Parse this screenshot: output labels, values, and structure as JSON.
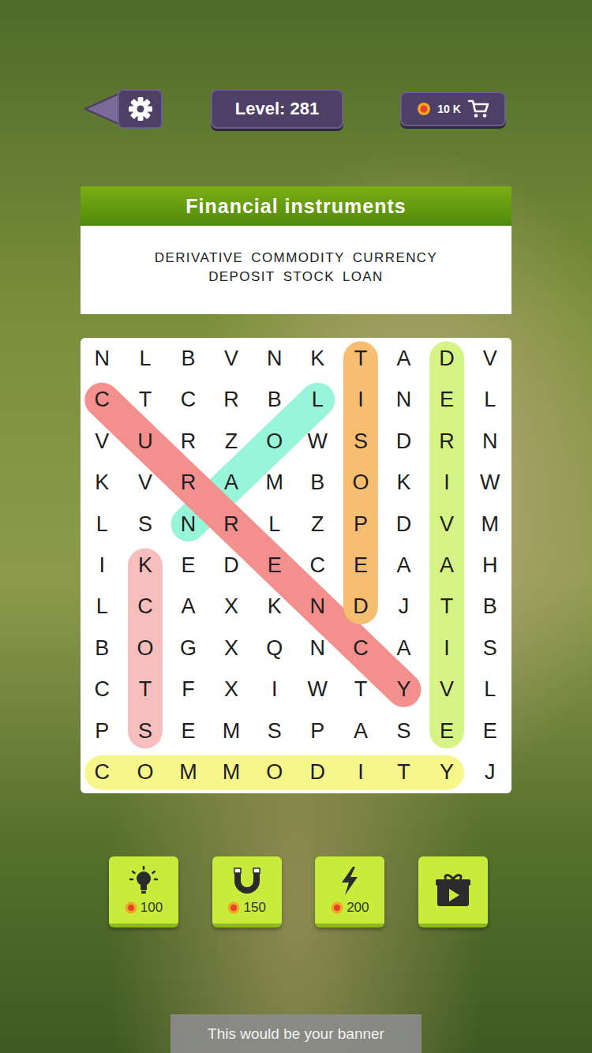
{
  "topbar": {
    "level": "Level: 281",
    "coins": "10 K"
  },
  "puzzle": {
    "title": "Financial instruments",
    "word_lines": [
      [
        "DERIVATIVE",
        "COMMODITY",
        "CURRENCY"
      ],
      [
        "DEPOSIT",
        "STOCK",
        "LOAN"
      ]
    ]
  },
  "grid": {
    "rows": [
      [
        "N",
        "L",
        "B",
        "V",
        "N",
        "K",
        "T",
        "A",
        "D",
        "V"
      ],
      [
        "C",
        "T",
        "C",
        "R",
        "B",
        "L",
        "I",
        "N",
        "E",
        "L"
      ],
      [
        "V",
        "U",
        "R",
        "Z",
        "O",
        "W",
        "S",
        "D",
        "R",
        "N"
      ],
      [
        "K",
        "V",
        "R",
        "A",
        "M",
        "B",
        "O",
        "K",
        "I",
        "W"
      ],
      [
        "L",
        "S",
        "N",
        "R",
        "L",
        "Z",
        "P",
        "D",
        "V",
        "M"
      ],
      [
        "I",
        "K",
        "E",
        "D",
        "E",
        "C",
        "E",
        "A",
        "A",
        "H"
      ],
      [
        "L",
        "C",
        "A",
        "X",
        "K",
        "N",
        "D",
        "J",
        "T",
        "B"
      ],
      [
        "B",
        "O",
        "G",
        "X",
        "Q",
        "N",
        "C",
        "A",
        "I",
        "S"
      ],
      [
        "C",
        "T",
        "F",
        "X",
        "I",
        "W",
        "T",
        "Y",
        "V",
        "L"
      ],
      [
        "P",
        "S",
        "E",
        "M",
        "S",
        "P",
        "A",
        "S",
        "E",
        "E"
      ],
      [
        "C",
        "O",
        "M",
        "M",
        "O",
        "D",
        "I",
        "T",
        "Y",
        "J"
      ]
    ]
  },
  "found": [
    {
      "word": "LOAN",
      "from": [
        1,
        5
      ],
      "to": [
        4,
        2
      ],
      "color": "#8ff5d6"
    },
    {
      "word": "CURRENCY",
      "from": [
        1,
        0
      ],
      "to": [
        8,
        7
      ],
      "color": "#f28482"
    },
    {
      "word": "DEPOSIT",
      "from": [
        6,
        6
      ],
      "to": [
        0,
        6
      ],
      "color": "#f7b862"
    },
    {
      "word": "DERIVATIVE",
      "from": [
        0,
        8
      ],
      "to": [
        9,
        8
      ],
      "color": "#d2f27a"
    },
    {
      "word": "STOCK",
      "from": [
        9,
        1
      ],
      "to": [
        5,
        1
      ],
      "color": "#f6b9b6"
    },
    {
      "word": "COMMODITY",
      "from": [
        10,
        0
      ],
      "to": [
        10,
        8
      ],
      "color": "#f6f67e"
    }
  ],
  "tools": [
    {
      "kind": "bulb",
      "price": "100"
    },
    {
      "kind": "magnet",
      "price": "150"
    },
    {
      "kind": "bolt",
      "price": "200"
    },
    {
      "kind": "video"
    }
  ],
  "banner": {
    "text": "This would be your banner"
  }
}
